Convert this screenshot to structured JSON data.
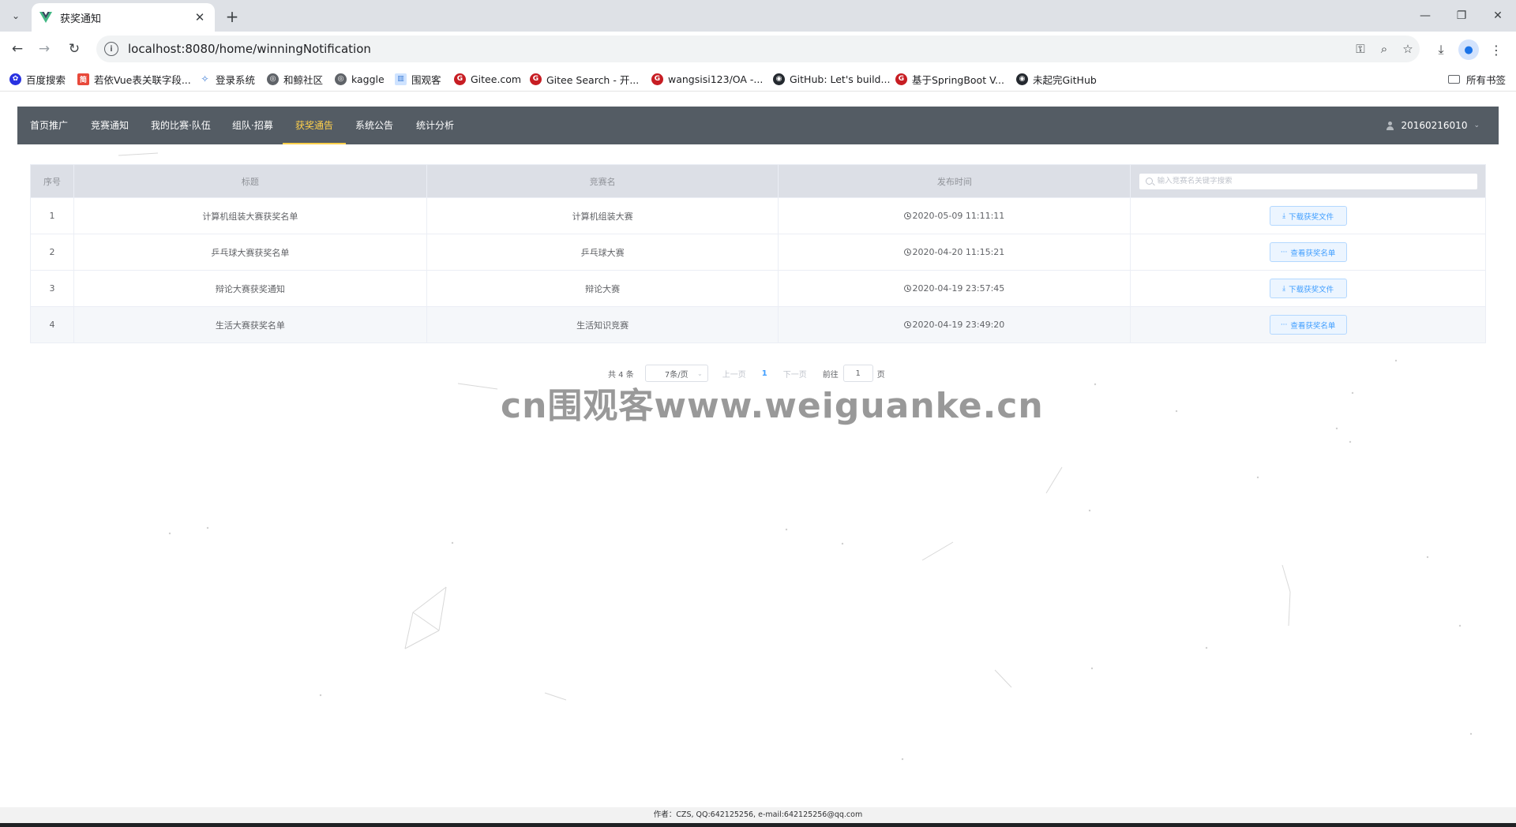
{
  "browser": {
    "tab_title": "获奖通知",
    "url": "localhost:8080/home/winningNotification",
    "bookmarks": [
      "百度搜索",
      "若依Vue表关联字段...",
      "登录系统",
      "和鲸社区",
      "kaggle",
      "围观客",
      "Gitee.com",
      "Gitee Search - 开...",
      "wangsisi123/OA -...",
      "GitHub: Let's build...",
      "基于SpringBoot V...",
      "未起完GitHub"
    ],
    "all_bookmarks": "所有书签"
  },
  "nav": {
    "items": [
      "首页推广",
      "竞赛通知",
      "我的比赛·队伍",
      "组队·招募",
      "获奖通告",
      "系统公告",
      "统计分析"
    ],
    "active": "获奖通告",
    "user": "20160216010"
  },
  "table": {
    "headers": [
      "序号",
      "标题",
      "竞赛名",
      "发布时间"
    ],
    "search_placeholder": "输入竞赛名关键字搜索",
    "rows": [
      {
        "index": "1",
        "title": "计算机组装大赛获奖名单",
        "competition": "计算机组装大赛",
        "time": "2020-05-09 11:11:11",
        "action": "下载获奖文件"
      },
      {
        "index": "2",
        "title": "乒乓球大赛获奖名单",
        "competition": "乒乓球大赛",
        "time": "2020-04-20 11:15:21",
        "action": "查看获奖名单"
      },
      {
        "index": "3",
        "title": "辩论大赛获奖通知",
        "competition": "辩论大赛",
        "time": "2020-04-19 23:57:45",
        "action": "下载获奖文件"
      },
      {
        "index": "4",
        "title": "生活大赛获奖名单",
        "competition": "生活知识竞赛",
        "time": "2020-04-19 23:49:20",
        "action": "查看获奖名单"
      }
    ]
  },
  "pagination": {
    "total": "共 4 条",
    "page_size": "7条/页",
    "prev": "上一页",
    "current": "1",
    "next": "下一页",
    "goto": "前往",
    "goto_value": "1",
    "page_unit": "页"
  },
  "watermark": "cn围观客www.weiguanke.cn",
  "footer": "作者：CZS, QQ:642125256, e-mail:642125256@qq.com",
  "colors": {
    "nav_bg": "#545c64",
    "nav_active": "#ffd04b",
    "accent": "#409eff",
    "header_bg": "#dcdfe6"
  }
}
